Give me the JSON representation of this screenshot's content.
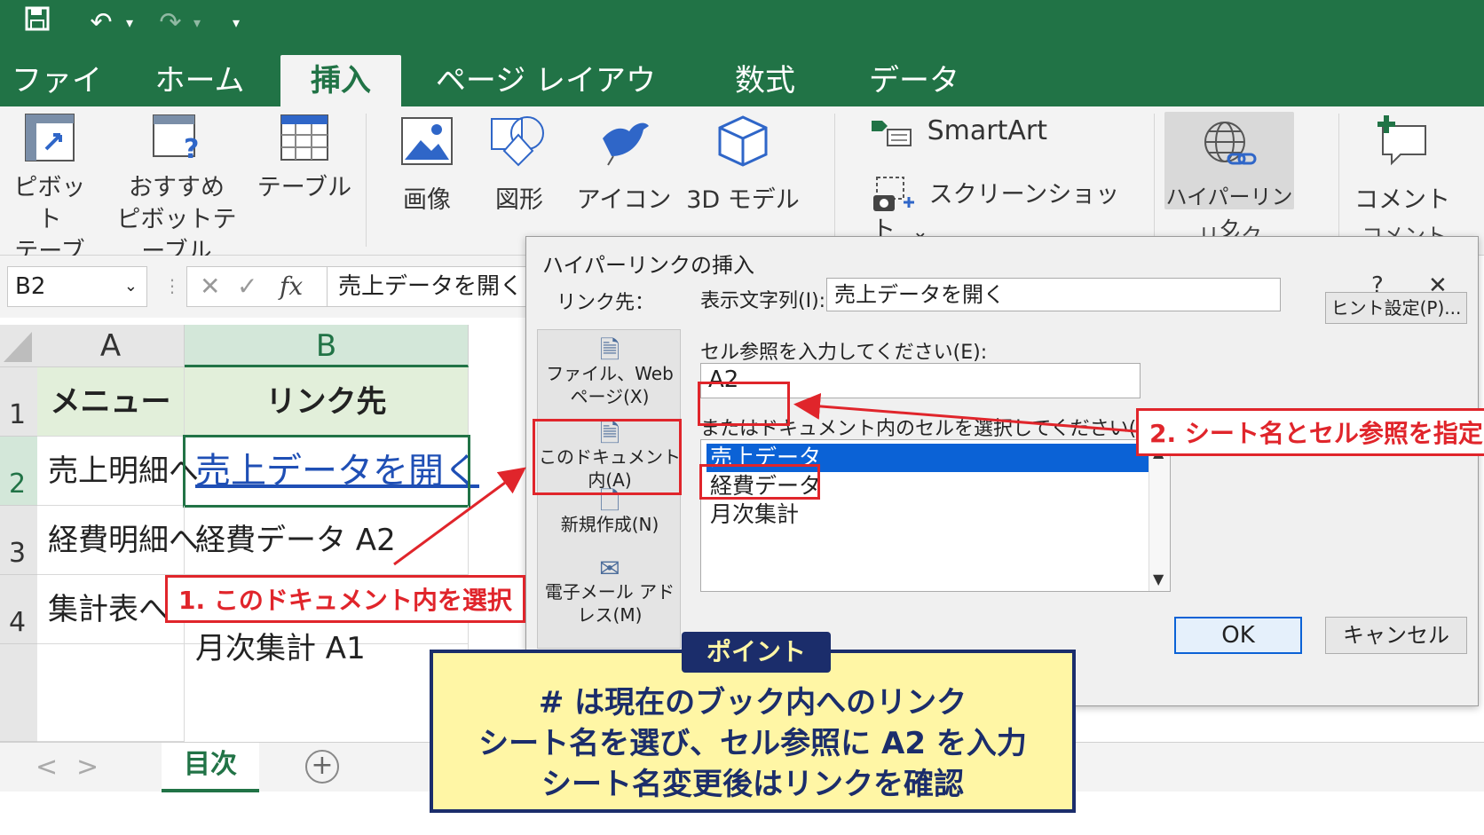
{
  "quick_access": {
    "save_icon": "save-icon",
    "undo_icon": "undo-icon",
    "redo_icon": "redo-icon",
    "customize_icon": "customize-icon"
  },
  "tabs": [
    {
      "label": "ファイル",
      "active": false
    },
    {
      "label": "ホーム",
      "active": false
    },
    {
      "label": "挿入",
      "active": true
    },
    {
      "label": "ページ レイアウト",
      "active": false
    },
    {
      "label": "数式",
      "active": false
    },
    {
      "label": "データ",
      "active": false
    }
  ],
  "ribbon": {
    "pivot_table": [
      "ピボット",
      "テーブル"
    ],
    "recommended_pivot": [
      "おすすめ",
      "ピボットテーブル"
    ],
    "table": "テーブル",
    "image": "画像",
    "shapes": "図形",
    "icons": "アイコン",
    "model3d": "3D モデル",
    "smartart": "SmartArt",
    "screenshot": "スクリーンショット",
    "screenshot_arrow": "⌄",
    "hyperlink": "ハイパーリンク",
    "link_group": "リンク",
    "comment": "コメント",
    "comment_group": "コメント"
  },
  "formula_bar": {
    "name_box": "B2",
    "name_arrow": "⌄",
    "cancel": "✕",
    "enter": "✓",
    "fx": "fx",
    "content": "売上データを開く"
  },
  "sheet": {
    "columns": [
      "A",
      "B"
    ],
    "rows": [
      "1",
      "2",
      "3",
      "4"
    ],
    "cells": {
      "a1": "メニュー",
      "b1": "リンク先",
      "a2": "売上明細へ",
      "b2": "売上データを開く",
      "a3": "経費明細へ",
      "b3": "経費データ A2",
      "a4": "集計表へ",
      "b5": "月次集計 A1"
    }
  },
  "sheet_tabs": {
    "prev": "<",
    "next": ">",
    "active": "目次",
    "add": "+"
  },
  "dialog": {
    "title": "ハイパーリンクの挿入",
    "help": "?",
    "close": "✕",
    "link_to_label": "リンク先：",
    "link_to_items": [
      {
        "line1": "ファイル、Web",
        "line2": "ページ(X)",
        "icon": "web-file-icon"
      },
      {
        "line1": "このドキュメント内(A)",
        "line2": "",
        "icon": "document-icon"
      },
      {
        "line1": "新規作成(N)",
        "line2": "",
        "icon": "new-document-icon"
      },
      {
        "line1": "電子メール アドレス(M)",
        "line2": "",
        "icon": "mail-icon"
      }
    ],
    "display_text_label": "表示文字列(I):",
    "display_text_value": "売上データを開く",
    "screen_tip_button": "ヒント設定(P)...",
    "cell_ref_label": "セル参照を入力してください(E):",
    "cell_ref_value": "A2",
    "select_place_label": "またはドキュメント内のセルを選択してください(C):",
    "places": [
      "売上データ",
      "経費データ",
      "月次集計"
    ],
    "selected_place": "売上データ",
    "ok": "OK",
    "cancel": "キャンセル"
  },
  "annotations": {
    "step1": "1. このドキュメント内を選択",
    "step2": "2. シート名とセル参照を指定",
    "point_tag": "ポイント",
    "point_lines": [
      "# は現在のブック内へのリンク",
      "シート名を選び、セル参照に A2 を入力",
      "シート名変更後はリンクを確認"
    ],
    "accent_red": "#e0252b",
    "accent_navy": "#1b2d6b",
    "excel_green": "#217346"
  }
}
